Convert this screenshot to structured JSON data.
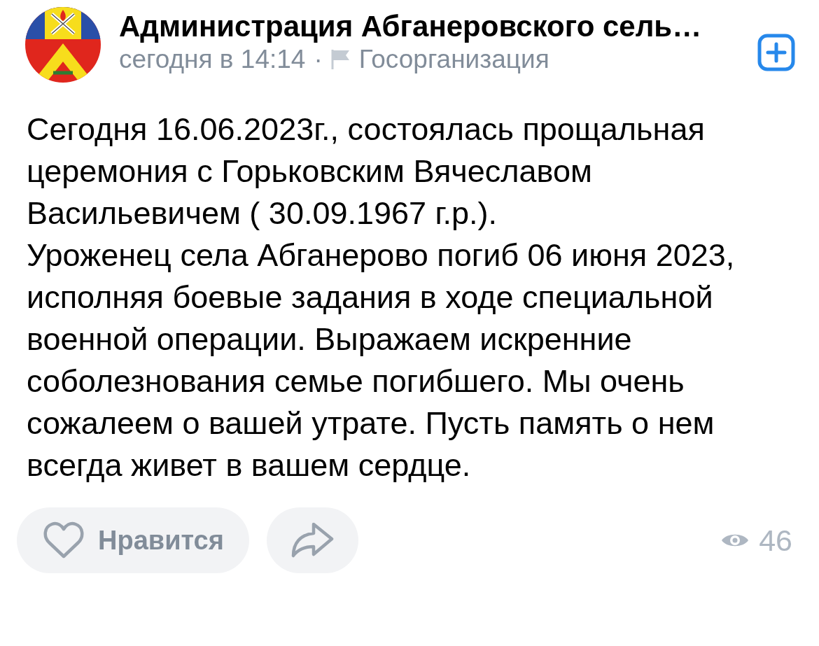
{
  "post": {
    "author": {
      "name": "Администрация Абганеровского сель…",
      "time": "сегодня в 14:14",
      "separator": "·",
      "badge": "Госорганизация"
    },
    "subscribed": false
  },
  "text": [
    "Сегодня 16.06.2023г., состоялась прощальная церемония с Горьковским Вячеславом Васильевичем ( 30.09.1967 г.р.).",
    "Уроженец села Абганерово погиб 06 июня 2023, исполняя боевые задания в ходе специальной военной операции. Выражаем искренние соболезнования семье погибшего. Мы очень сожалеем о вашей утрате. Пусть память о нем всегда живет в вашем сердце."
  ],
  "actions": {
    "like": {
      "label": "Нравится",
      "liked": false
    },
    "views": "46"
  }
}
